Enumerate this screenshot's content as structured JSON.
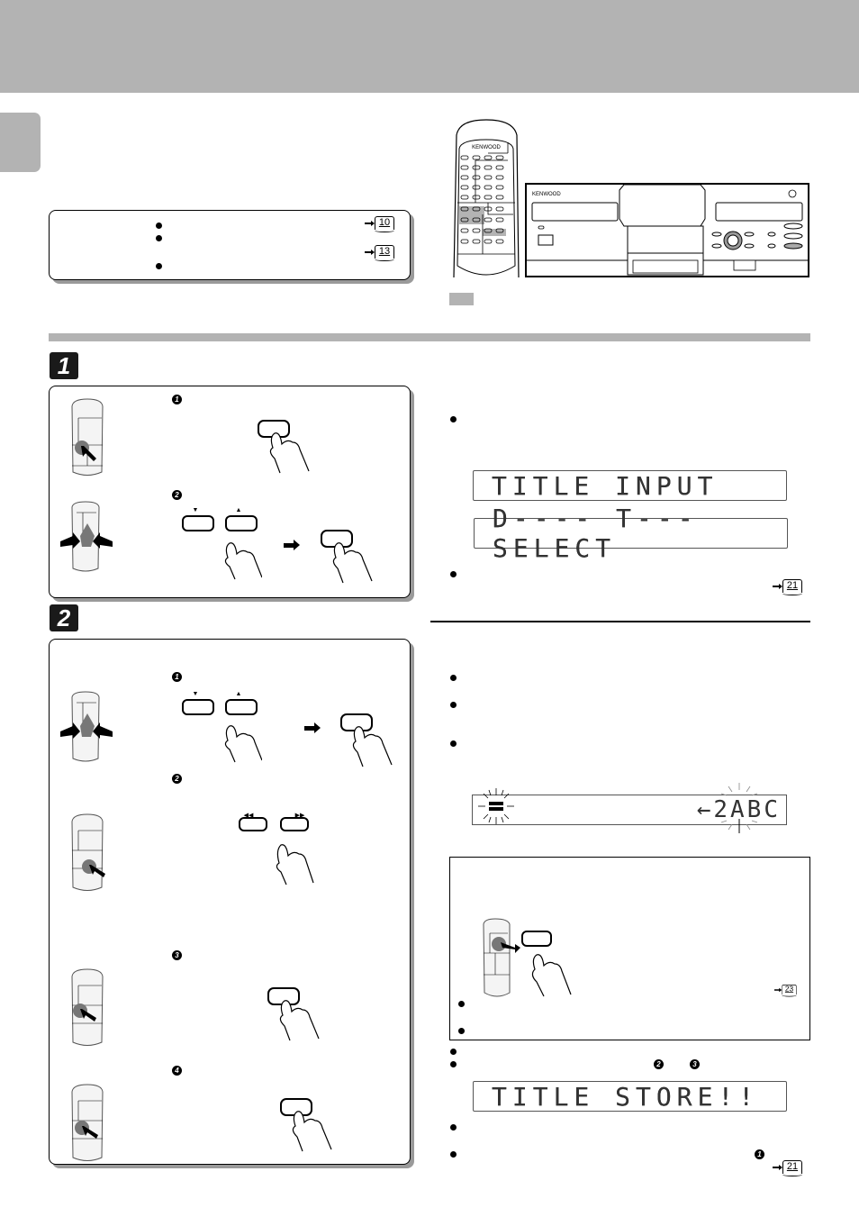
{
  "page": {
    "header_band_color": "#b3b3b3",
    "accent_gray": "#b3b3b3"
  },
  "prereq_box": {
    "bullets": 3,
    "page_refs": [
      "10",
      "13"
    ]
  },
  "device_illustration": {
    "remote_brand": "KENWOOD",
    "deck_brand": "KENWOOD",
    "legend_swatch": "gray-highlighted-keys"
  },
  "step1": {
    "number": "1",
    "substeps": [
      {
        "marker": "1",
        "keys": [
          "button"
        ]
      },
      {
        "marker": "2",
        "keys": [
          "▼",
          "▲"
        ],
        "then": "button"
      }
    ],
    "notes": {
      "bullet_count": 2,
      "page_ref": "21"
    },
    "lcd_displays": [
      "TITLE INPUT",
      "D----  T---  SELECT"
    ]
  },
  "step2": {
    "number": "2",
    "substeps": [
      {
        "marker": "1",
        "keys": [
          "▼",
          "▲"
        ],
        "then": "button"
      },
      {
        "marker": "2",
        "keys": [
          "◀◀",
          "▶▶"
        ]
      },
      {
        "marker": "3",
        "keys": [
          "button"
        ]
      },
      {
        "marker": "4",
        "keys": [
          "button"
        ]
      }
    ],
    "notes": {
      "bullet_count": 3,
      "lcd_cursor_display": "←2ABC"
    },
    "note_box": {
      "bullet_count": 2,
      "page_ref": "23"
    },
    "after_notes": {
      "bullet_markers": [
        "2",
        "3"
      ],
      "lcd_display": "TITLE STORE!!",
      "final_marker": "1",
      "page_ref": "21"
    }
  }
}
